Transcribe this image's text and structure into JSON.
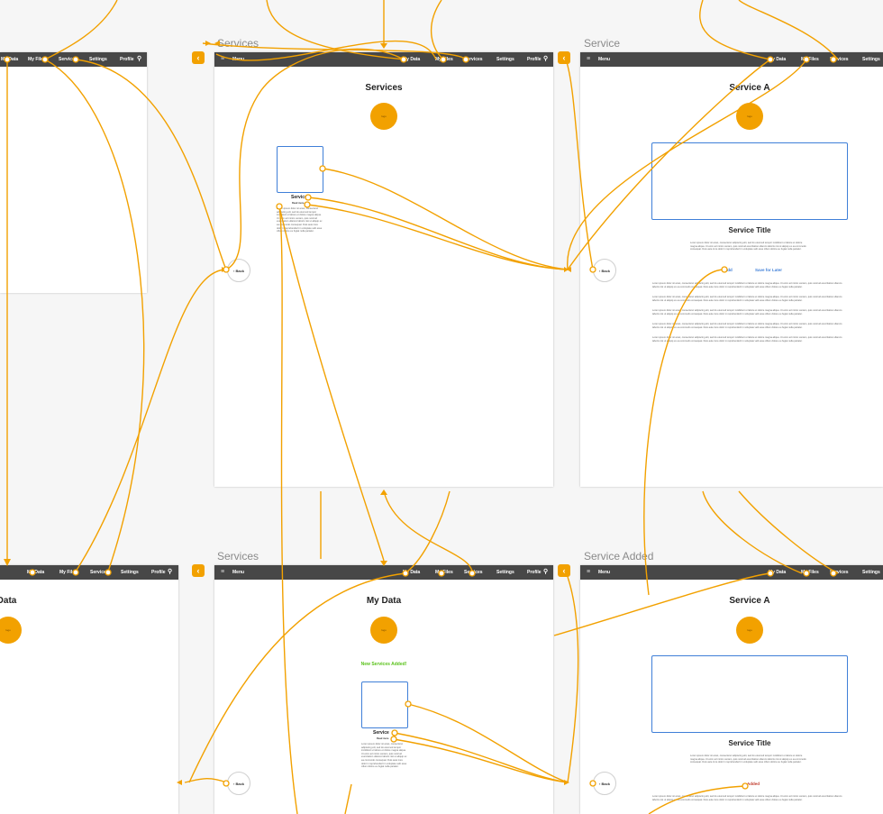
{
  "artboards": {
    "services_top": "Services",
    "service_top": "Service",
    "services_bottom": "Services",
    "service_added_bottom": "Service Added"
  },
  "nav": {
    "menu": "Menu",
    "my_data": "My Data",
    "my_files": "My Files",
    "services": "Services",
    "settings": "Settings",
    "profile": "Profile"
  },
  "screens": {
    "services": {
      "title": "Services",
      "logo": "logo",
      "card_label": "Service",
      "card_sub": "Read more"
    },
    "service_a": {
      "title": "Service A",
      "logo": "logo",
      "service_title": "Service Title",
      "add": "Add",
      "save_later": "Save for Later"
    },
    "my_data": {
      "title": "My Data",
      "logo": "logo",
      "notice": "New Services Added!",
      "card_label": "Service",
      "card_sub": "Read more"
    },
    "service_a_added": {
      "title": "Service A",
      "logo": "logo",
      "service_title": "Service Title",
      "added": "Added"
    },
    "left_partial_bottom": {
      "title": "My Data",
      "logo": "logo"
    }
  },
  "back_label": "Back",
  "back_arrow": "‹",
  "lorem": "Lorem ipsum dolor sit amet, consectetur adipiscing elit, sed do eiusmod tempor incididunt ut labore et dolore magna aliqua. Ut enim ad minim veniam, quis nostrud exercitation ullamco laboris nisi ut aliquip ex ea commodo consequat. Duis aute irure dolor in reprehenderit in voluptate velit esse cillum dolore eu fugiat nulla pariatur.",
  "colors": {
    "accent": "#f2a100",
    "navbar": "#474747",
    "link": "#3f7fd8",
    "success": "#5ac21b"
  }
}
